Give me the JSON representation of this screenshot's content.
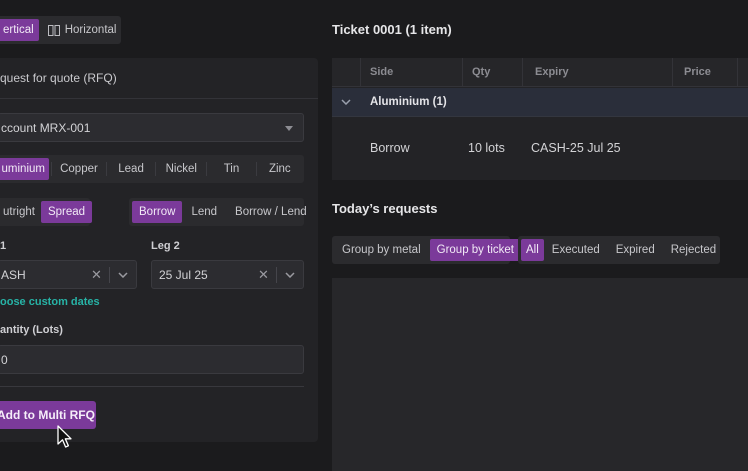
{
  "orientation": {
    "options": [
      "ertical",
      "Horizontal"
    ],
    "active": 0
  },
  "rfq": {
    "title": "quest for quote (RFQ)",
    "account": "ccount MRX-001",
    "metals": [
      "uminium",
      "Copper",
      "Lead",
      "Nickel",
      "Tin",
      "Zinc"
    ],
    "active_metal": 0,
    "trade_types": [
      "utright",
      "Spread"
    ],
    "active_trade_type": 1,
    "directions": [
      "Borrow",
      "Lend",
      "Borrow / Lend"
    ],
    "active_direction": 0,
    "leg1": {
      "label": "1",
      "value": "ASH"
    },
    "leg2": {
      "label": "Leg 2",
      "value": "25 Jul 25"
    },
    "custom_dates_link": "oose custom dates",
    "quantity": {
      "label": "antity (Lots)",
      "value": "0"
    },
    "submit_label": "Add to Multi RFQ"
  },
  "ticket": {
    "title": "Ticket 0001 (1 item)",
    "columns": [
      "Side",
      "Qty",
      "Expiry",
      "Price"
    ],
    "group_label": "Aluminium (1)",
    "rows": [
      {
        "side": "Borrow",
        "qty": "10 lots",
        "expiry": "CASH-25 Jul 25",
        "price": ""
      }
    ]
  },
  "requests": {
    "title": "Today’s requests",
    "grouping": [
      "Group by metal",
      "Group by ticket"
    ],
    "active_grouping": 1,
    "filters": [
      "All",
      "Executed",
      "Expired",
      "Rejected"
    ],
    "active_filter": 0
  },
  "colors": {
    "accent": "#7b3a9a",
    "link": "#27b3a6",
    "background": "#1b1b1d"
  }
}
